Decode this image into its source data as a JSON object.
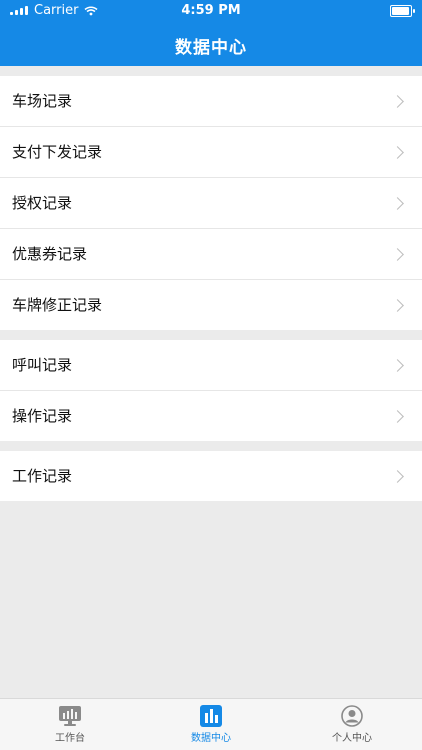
{
  "status": {
    "carrier": "Carrier",
    "time": "4:59 PM"
  },
  "header": {
    "title": "数据中心"
  },
  "groups": [
    [
      {
        "label": "车场记录"
      },
      {
        "label": "支付下发记录"
      },
      {
        "label": "授权记录"
      },
      {
        "label": "优惠券记录"
      },
      {
        "label": "车牌修正记录"
      }
    ],
    [
      {
        "label": "呼叫记录"
      },
      {
        "label": "操作记录"
      }
    ],
    [
      {
        "label": "工作记录"
      }
    ]
  ],
  "tabs": [
    {
      "label": "工作台",
      "icon": "desk-monitor-icon",
      "active": false
    },
    {
      "label": "数据中心",
      "icon": "bar-chart-icon",
      "active": true
    },
    {
      "label": "个人中心",
      "icon": "user-icon",
      "active": false
    }
  ],
  "colors": {
    "primary": "#1589e6",
    "background": "#ebebeb"
  }
}
